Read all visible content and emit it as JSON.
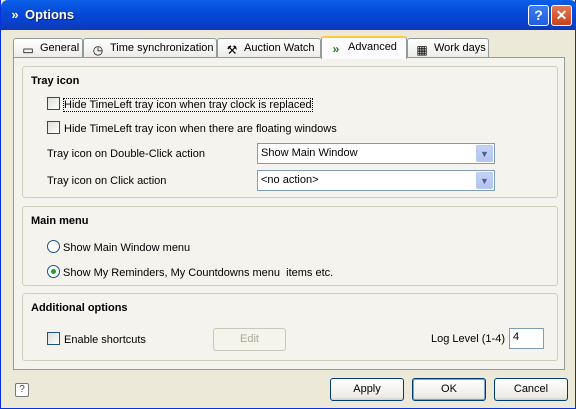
{
  "window": {
    "title": "Options",
    "title_icon": "double-chevron-icon",
    "help_label": "?",
    "close_label": "✕"
  },
  "tabs": [
    {
      "label": "General",
      "icon": "computer-icon"
    },
    {
      "label": "Time synchronization",
      "icon": "clock-icon"
    },
    {
      "label": "Auction Watch",
      "icon": "gavel-icon"
    },
    {
      "label": "Advanced",
      "icon": "double-chevron-icon",
      "active": true
    },
    {
      "label": "Work days",
      "icon": "calendar-grid-icon"
    }
  ],
  "tray": {
    "title": "Tray icon",
    "hide_replaced_label": "Hide TimeLeft tray icon when tray clock is replaced",
    "hide_replaced_checked": false,
    "hide_floating_label": "Hide TimeLeft tray icon when there are floating windows",
    "hide_floating_checked": false,
    "dblclick_label": "Tray icon on Double-Click action",
    "dblclick_value": "Show Main Window",
    "click_label": "Tray icon on Click action",
    "click_value": "<no action>"
  },
  "main_menu": {
    "title": "Main menu",
    "option1_label": "Show Main Window menu",
    "option2_label": "Show My Reminders, My Countdowns menu  items etc.",
    "selected": 2
  },
  "additional": {
    "title": "Additional options",
    "shortcuts_label": "Enable shortcuts",
    "shortcuts_checked": false,
    "edit_label": "Edit",
    "log_level_label": "Log Level (1-4)",
    "log_level_value": "4"
  },
  "buttons": {
    "apply": "Apply",
    "ok": "OK",
    "cancel": "Cancel"
  },
  "status_icon": "help-icon"
}
